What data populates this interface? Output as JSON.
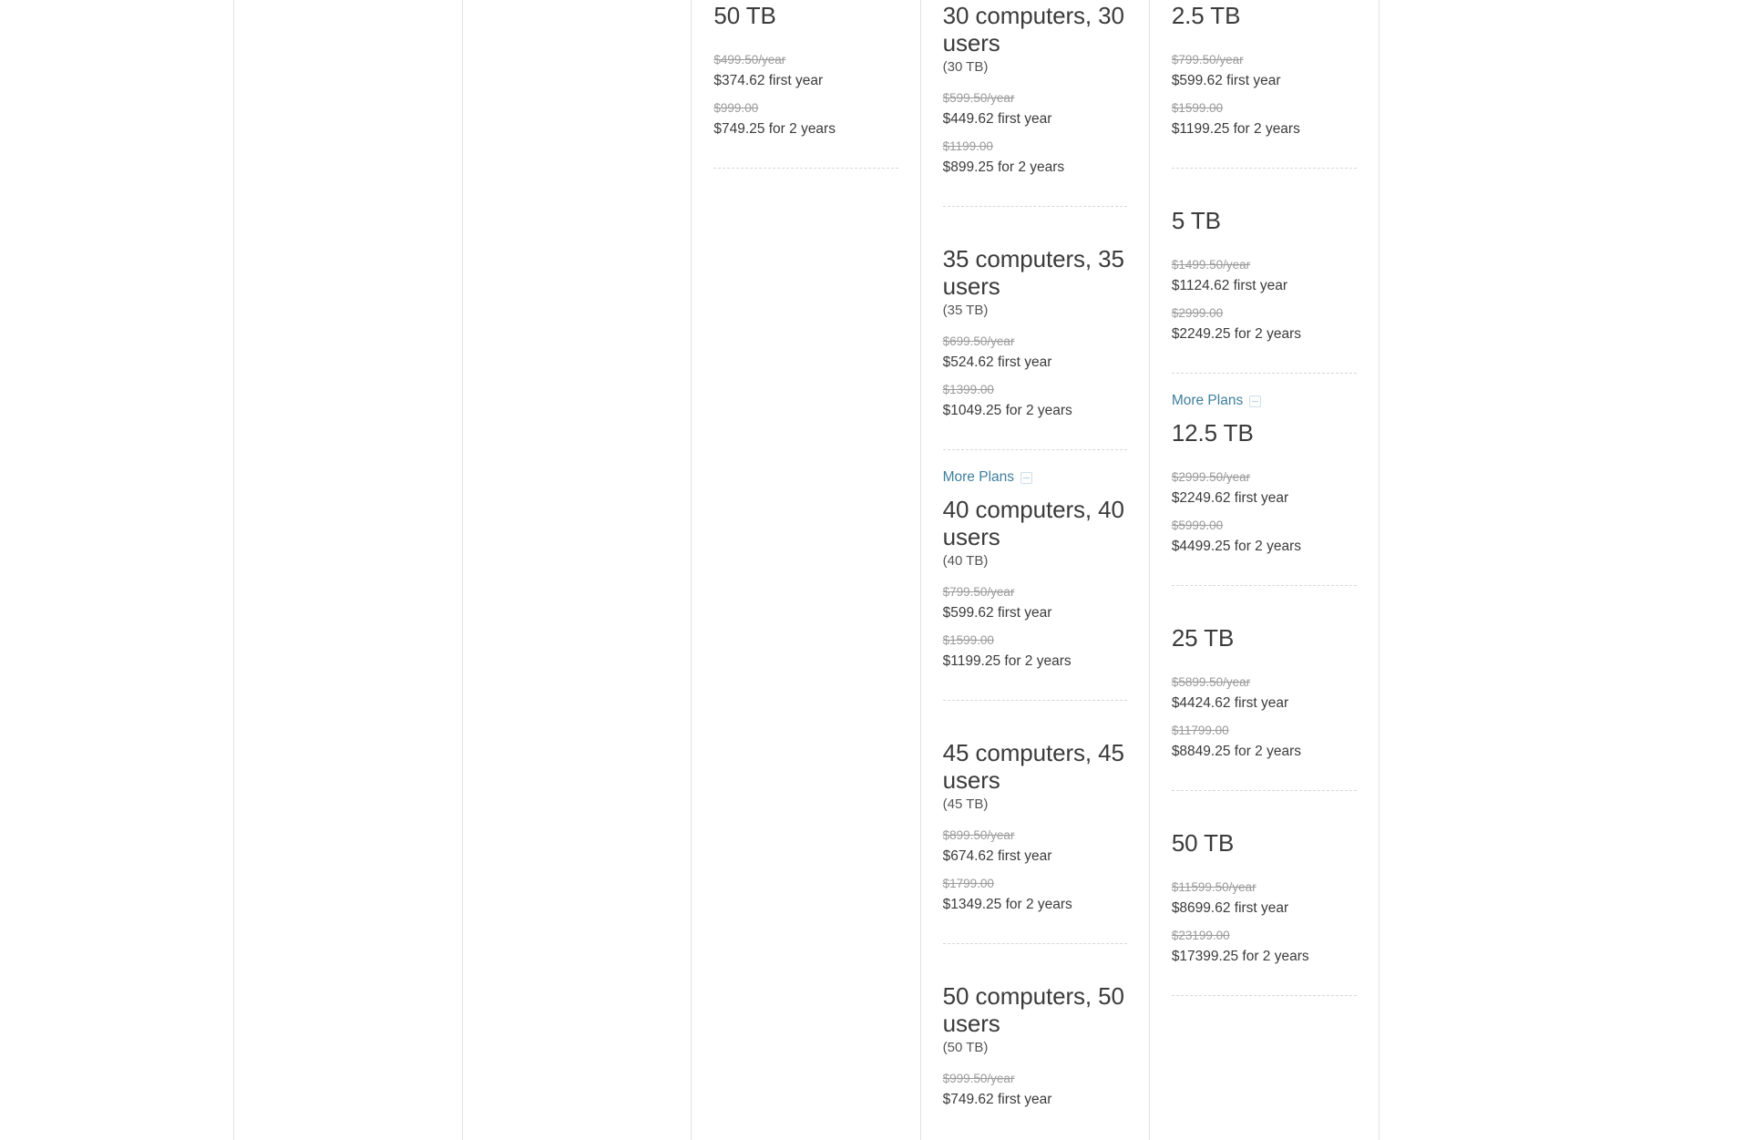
{
  "theme": {
    "background": "#ffffff",
    "divider": "#e2e2e2",
    "dashed_separator": "#d8d8d8",
    "title_color": "#3b3b3b",
    "strike_color": "#9a9a9a",
    "link_color": "#3f7f9b"
  },
  "columns": [
    {
      "id": "col-empty-1",
      "plans": []
    },
    {
      "id": "col-empty-2",
      "plans": []
    },
    {
      "id": "col-storage-small",
      "plans": [
        {
          "title": "50 TB",
          "sub": "",
          "old_year": "$499.50",
          "year_unit": "/year",
          "first_year": "$374.62 first year",
          "old_two_year": "$999.00",
          "two_year": "$749.25 for 2 years",
          "separator_after": true
        }
      ],
      "more_plans": null
    },
    {
      "id": "col-computers-users",
      "plans": [
        {
          "title": "30 computers, 30 users",
          "sub": "(30 TB)",
          "old_year": "$599.50",
          "year_unit": "/year",
          "first_year": "$449.62 first year",
          "old_two_year": "$1199.00",
          "two_year": "$899.25 for 2 years",
          "separator_after": true
        },
        {
          "title": "35 computers, 35 users",
          "sub": "(35 TB)",
          "old_year": "$699.50",
          "year_unit": "/year",
          "first_year": "$524.62 first year",
          "old_two_year": "$1399.00",
          "two_year": "$1049.25 for 2 years",
          "separator_after": true
        }
      ],
      "more_plans": {
        "label": "More Plans",
        "icon": "collapse-box-icon"
      },
      "extra_plans": [
        {
          "title": "40 computers, 40 users",
          "sub": "(40 TB)",
          "old_year": "$799.50",
          "year_unit": "/year",
          "first_year": "$599.62 first year",
          "old_two_year": "$1599.00",
          "two_year": "$1199.25 for 2 years",
          "separator_after": true
        },
        {
          "title": "45 computers, 45 users",
          "sub": "(45 TB)",
          "old_year": "$899.50",
          "year_unit": "/year",
          "first_year": "$674.62 first year",
          "old_two_year": "$1799.00",
          "two_year": "$1349.25 for 2 years",
          "separator_after": true
        },
        {
          "title": "50 computers, 50 users",
          "sub": "(50 TB)",
          "old_year": "$999.50",
          "year_unit": "/year",
          "first_year": "$749.62 first year",
          "old_two_year": "",
          "two_year": "",
          "separator_after": false
        }
      ]
    },
    {
      "id": "col-storage-large",
      "plans": [
        {
          "title": "2.5 TB",
          "sub": "",
          "old_year": "$799.50",
          "year_unit": "/year",
          "first_year": "$599.62 first year",
          "old_two_year": "$1599.00",
          "two_year": "$1199.25 for 2 years",
          "separator_after": true
        },
        {
          "title": "5 TB",
          "sub": "",
          "old_year": "$1499.50",
          "year_unit": "/year",
          "first_year": "$1124.62 first year",
          "old_two_year": "$2999.00",
          "two_year": "$2249.25 for 2 years",
          "separator_after": true
        }
      ],
      "more_plans": {
        "label": "More Plans",
        "icon": "collapse-box-icon"
      },
      "extra_plans": [
        {
          "title": "12.5 TB",
          "sub": "",
          "old_year": "$2999.50",
          "year_unit": "/year",
          "first_year": "$2249.62 first year",
          "old_two_year": "$5999.00",
          "two_year": "$4499.25 for 2 years",
          "separator_after": true
        },
        {
          "title": "25 TB",
          "sub": "",
          "old_year": "$5899.50",
          "year_unit": "/year",
          "first_year": "$4424.62 first year",
          "old_two_year": "$11799.00",
          "two_year": "$8849.25 for 2 years",
          "separator_after": true
        },
        {
          "title": "50 TB",
          "sub": "",
          "old_year": "$11599.50",
          "year_unit": "/year",
          "first_year": "$8699.62 first year",
          "old_two_year": "$23199.00",
          "two_year": "$17399.25 for 2 years",
          "separator_after": true
        }
      ]
    }
  ]
}
